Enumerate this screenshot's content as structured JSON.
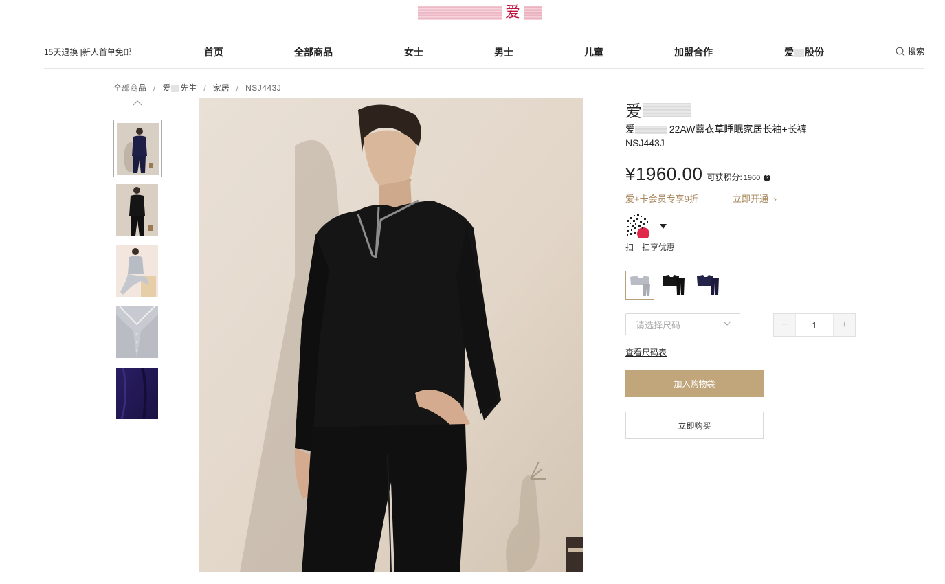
{
  "logo": {
    "mark": "爱"
  },
  "header": {
    "promo": "15天退换 |新人首单免邮",
    "nav": [
      {
        "label": "首页"
      },
      {
        "label": "全部商品"
      },
      {
        "label": "女士"
      },
      {
        "label": "男士"
      },
      {
        "label": "儿童"
      },
      {
        "label": "加盟合作"
      },
      {
        "label_prefix": "爱",
        "label_suffix": "股份"
      }
    ],
    "search_label": "搜索"
  },
  "breadcrumb": {
    "items": [
      "全部商品",
      "先生",
      "家居"
    ],
    "item2_prefix": "爱",
    "current": "NSJ443J",
    "separator": "/"
  },
  "product": {
    "brand_char": "爱",
    "title_prefix": "爱",
    "title_main": " 22AW薰衣草睡眠家居长袖+长裤NSJ443J",
    "price": "¥1960.00",
    "points_label": "可获积分:",
    "points_value": "1960",
    "help_mark": "?",
    "member_offer": "爱+卡会员专享9折",
    "member_open": "立即开通",
    "member_open_arrow": "›",
    "qr_label": "扫一扫享优惠",
    "colors": [
      "gray",
      "black",
      "navy"
    ],
    "size_placeholder": "请选择尺码",
    "quantity": "1",
    "minus": "−",
    "plus": "+",
    "size_chart": "查看尺码表",
    "add_to_bag": "加入购物袋",
    "buy_now": "立即购买"
  }
}
